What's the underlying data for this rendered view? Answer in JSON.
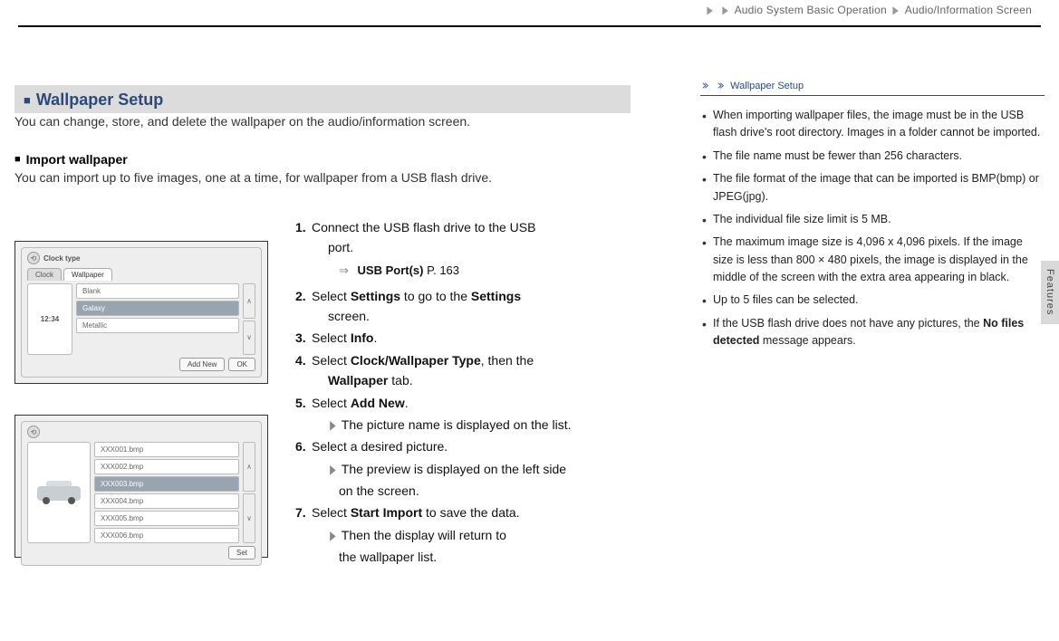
{
  "breadcrumb": {
    "seg1": "Audio System Basic Operation",
    "seg2": "Audio/Information Screen"
  },
  "section": {
    "title": "Wallpaper Setup",
    "intro": "You can change, store, and delete the wallpaper on the audio/information screen."
  },
  "import": {
    "heading": "Import wallpaper",
    "desc": "You can import up to five images, one at a time, for wallpaper from a USB flash drive."
  },
  "steps": {
    "s1_a": "Connect the USB flash drive to the USB",
    "s1_b": "port.",
    "s1_link_label": "USB Port(s)",
    "s1_link_page": "P. 163",
    "s2_a": "Select ",
    "s2_b1": "Settings",
    "s2_c": " to go to the ",
    "s2_b2": "Settings",
    "s2_d": "screen.",
    "s3_a": "Select ",
    "s3_b": "Info",
    "s3_c": ".",
    "s4_a": "Select ",
    "s4_b": "Clock/Wallpaper Type",
    "s4_c": ", then the",
    "s4_d": "Wallpaper",
    "s4_e": " tab.",
    "s5_a": "Select ",
    "s5_b": "Add New",
    "s5_c": ".",
    "s5_sub": "The picture name is displayed on the list.",
    "s6": "Select a desired picture.",
    "s6_sub_a": "The preview is displayed on the left side",
    "s6_sub_b": "on the screen.",
    "s7_a": "Select ",
    "s7_b": "Start Import",
    "s7_c": " to save the data.",
    "s7_sub_a": "Then the display will return to",
    "s7_sub_b": "the wallpaper list."
  },
  "side": {
    "title": "Wallpaper Setup",
    "b1": "When importing wallpaper files, the image must be in the USB flash drive's root directory. Images in a folder cannot be imported.",
    "b2": "The file name must be fewer than 256 characters.",
    "b3": "The file format of the image that can be imported is BMP(bmp) or JPEG(jpg).",
    "b4": "The individual file size limit is 5 MB.",
    "b5": "The maximum image size is 4,096 x 4,096 pixels. If the image size is less than 800 × 480 pixels, the image is displayed in the middle of the screen with the extra area appearing in black.",
    "b6": "Up to 5 files can be selected.",
    "b7_a": "If the USB flash drive does not have any pictures, the ",
    "b7_b": "No files detected",
    "b7_c": " message appears."
  },
  "shot1": {
    "title": "Clock type",
    "tab1": "Clock",
    "tab2": "Wallpaper",
    "clock": "12:34",
    "row1": "Blank",
    "row2": "Galaxy",
    "row3": "Metallic",
    "btn1": "Add New",
    "btn2": "OK"
  },
  "shot2": {
    "rows": [
      "XXX001.bmp",
      "XXX002.bmp",
      "XXX003.bmp",
      "XXX004.bmp",
      "XXX005.bmp",
      "XXX006.bmp"
    ],
    "btn": "Set"
  },
  "vtab": "Features"
}
